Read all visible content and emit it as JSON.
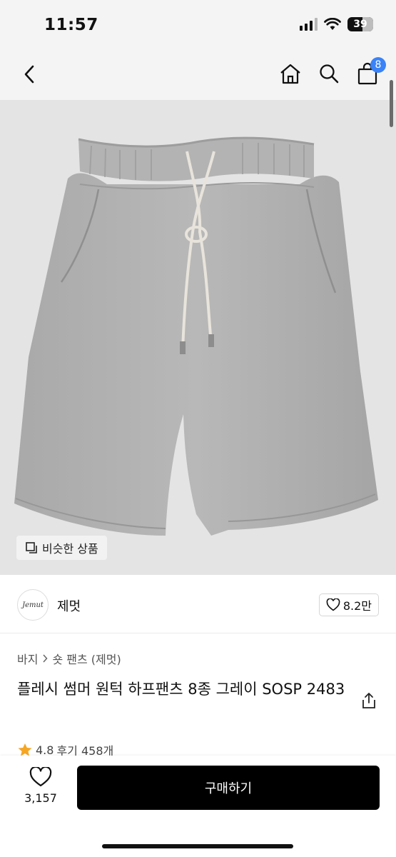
{
  "status_bar": {
    "time": "11:57",
    "battery": "39"
  },
  "header": {
    "back_icon": "chevron-left-icon",
    "home_icon": "home-icon",
    "search_icon": "search-icon",
    "cart_icon": "shopping-bag-icon",
    "cart_badge": "8",
    "badge_color": "#3a82f7"
  },
  "image": {
    "similar_label": "비슷한 상품"
  },
  "brand": {
    "logo_text": "Jemut",
    "name": "제멋",
    "likes": "8.2만"
  },
  "product": {
    "breadcrumb": [
      "바지",
      "숏 팬츠 (제멋)"
    ],
    "title": "플레시 썸머 원턱 하프팬츠 8종 그레이 SOSP 2483",
    "rating": "4.8",
    "reviews": "후기 458개"
  },
  "bottom": {
    "wish_count": "3,157",
    "buy_label": "구매하기"
  }
}
